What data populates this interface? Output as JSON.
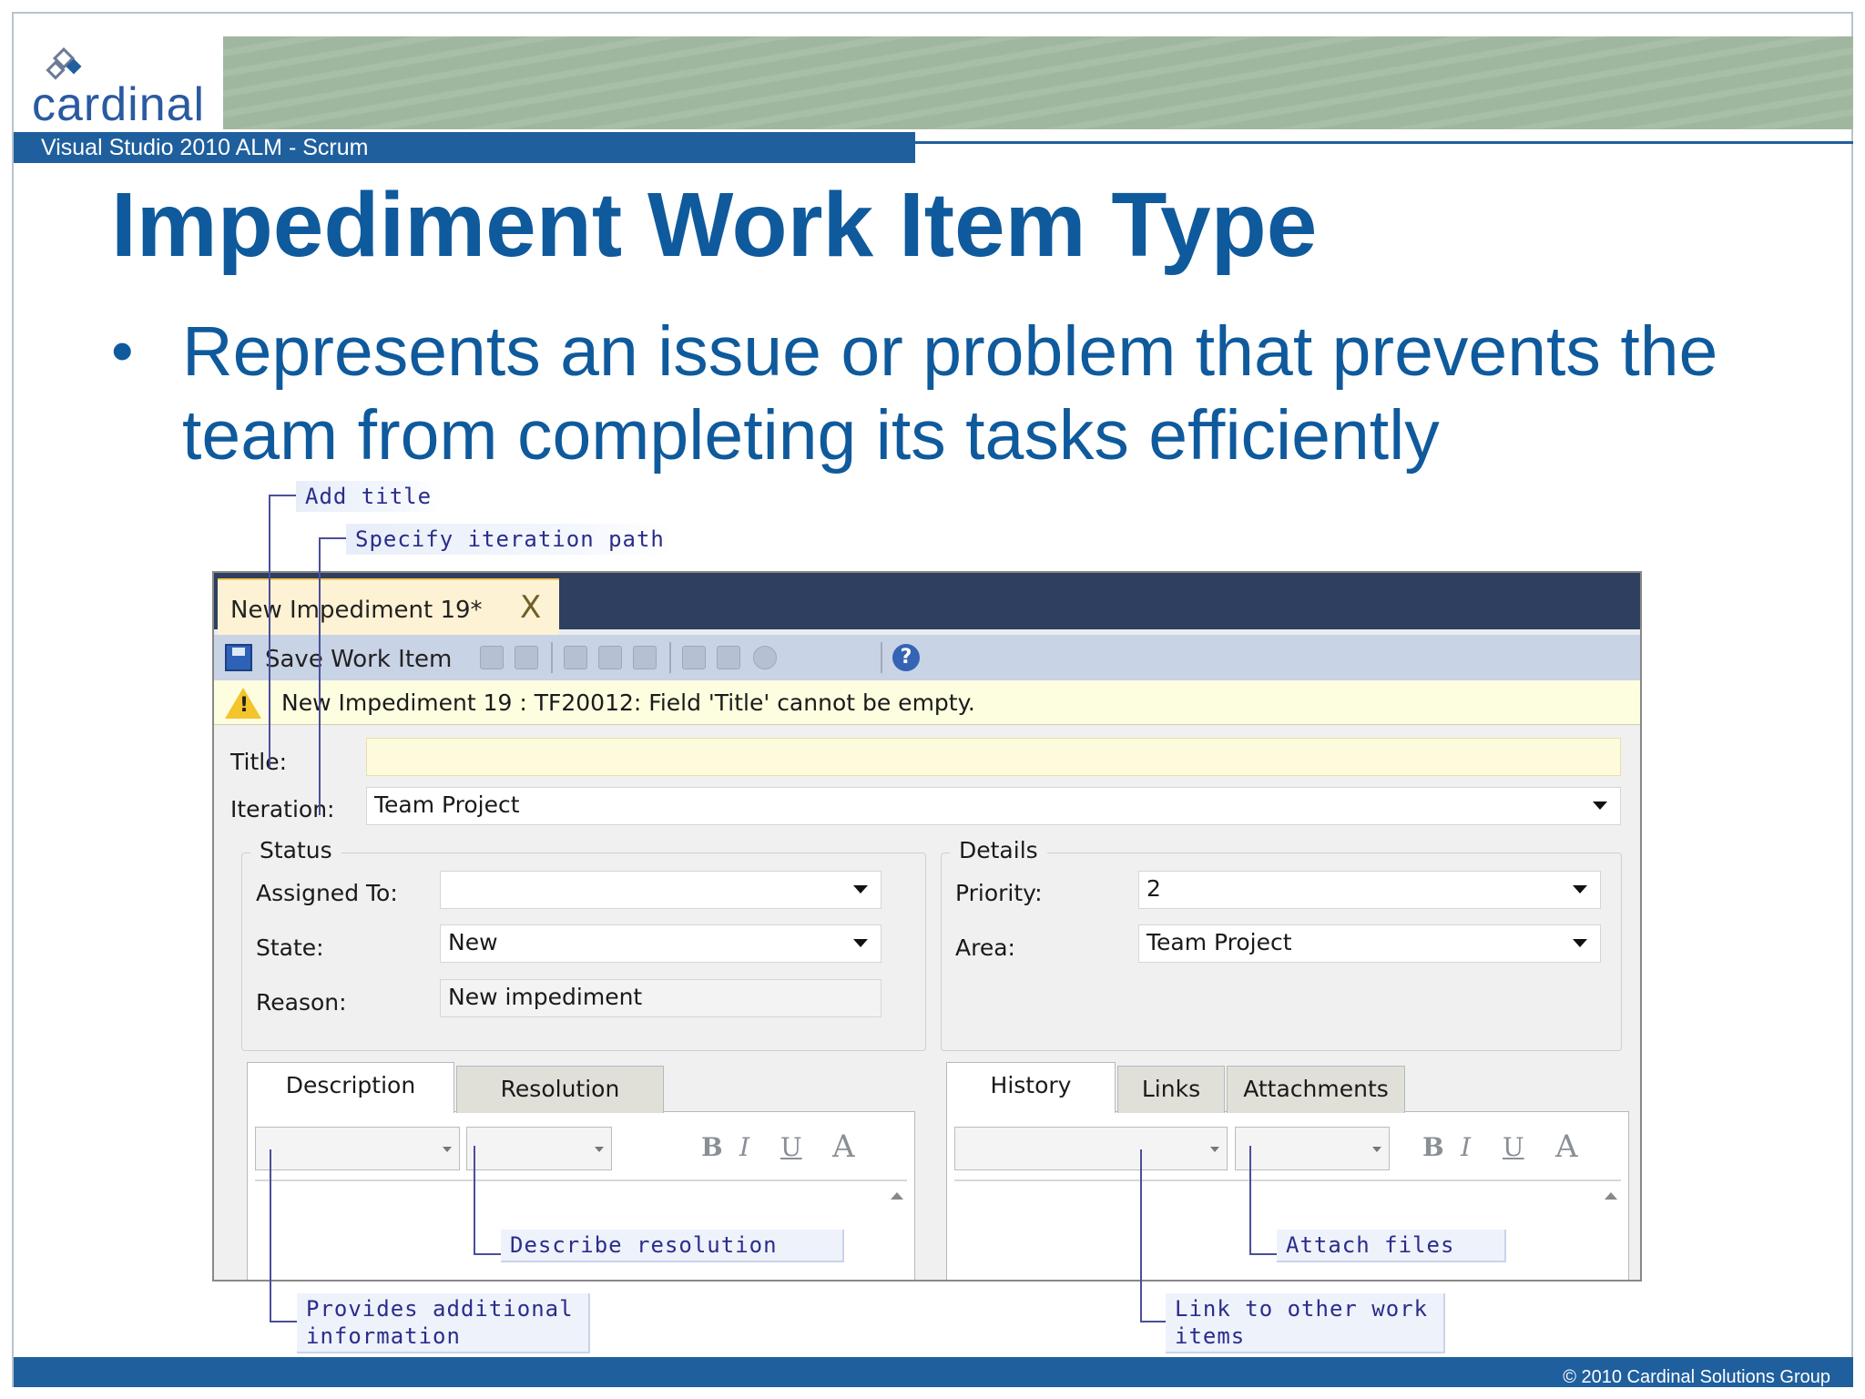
{
  "slide": {
    "logo_text": "cardinal",
    "subtitle_bar": "Visual Studio 2010 ALM - Scrum",
    "title": "Impediment Work Item Type",
    "bullet_symbol": "•",
    "bullet_text": "Represents an issue or problem that prevents the team from completing its tasks efficiently",
    "footer": "© 2010 Cardinal Solutions Group",
    "colors": {
      "brand_blue": "#0f5a9c",
      "bar_blue": "#1f5f9e",
      "banner_green": "#9fb79f"
    }
  },
  "window": {
    "doc_tab_label": "New Impediment 19*",
    "doc_tab_close": "X",
    "toolbar": {
      "save_label": "Save Work Item",
      "help_icon": "?"
    },
    "warning": {
      "icon": "!",
      "message": "New Impediment 19 : TF20012: Field 'Title' cannot be empty."
    },
    "form": {
      "title_label": "Title:",
      "title_value": "",
      "iteration_label": "Iteration:",
      "iteration_value": "Team Project",
      "status": {
        "group_label": "Status",
        "assigned_to_label": "Assigned To:",
        "assigned_to_value": "",
        "state_label": "State:",
        "state_value": "New",
        "reason_label": "Reason:",
        "reason_value": "New impediment"
      },
      "details": {
        "group_label": "Details",
        "priority_label": "Priority:",
        "priority_value": "2",
        "area_label": "Area:",
        "area_value": "Team Project"
      },
      "left_tabs": [
        "Description",
        "Resolution"
      ],
      "right_tabs": [
        "History",
        "Links",
        "Attachments"
      ],
      "format_buttons": {
        "bold": "B",
        "italic": "I",
        "underline": "U",
        "font_color": "A"
      }
    }
  },
  "callouts": {
    "add_title": "Add title",
    "iteration_path": "Specify iteration path",
    "describe_resolution": "Describe resolution",
    "attach_files": "Attach files",
    "additional_info": "Provides additional information",
    "link_items": "Link to other work items"
  }
}
